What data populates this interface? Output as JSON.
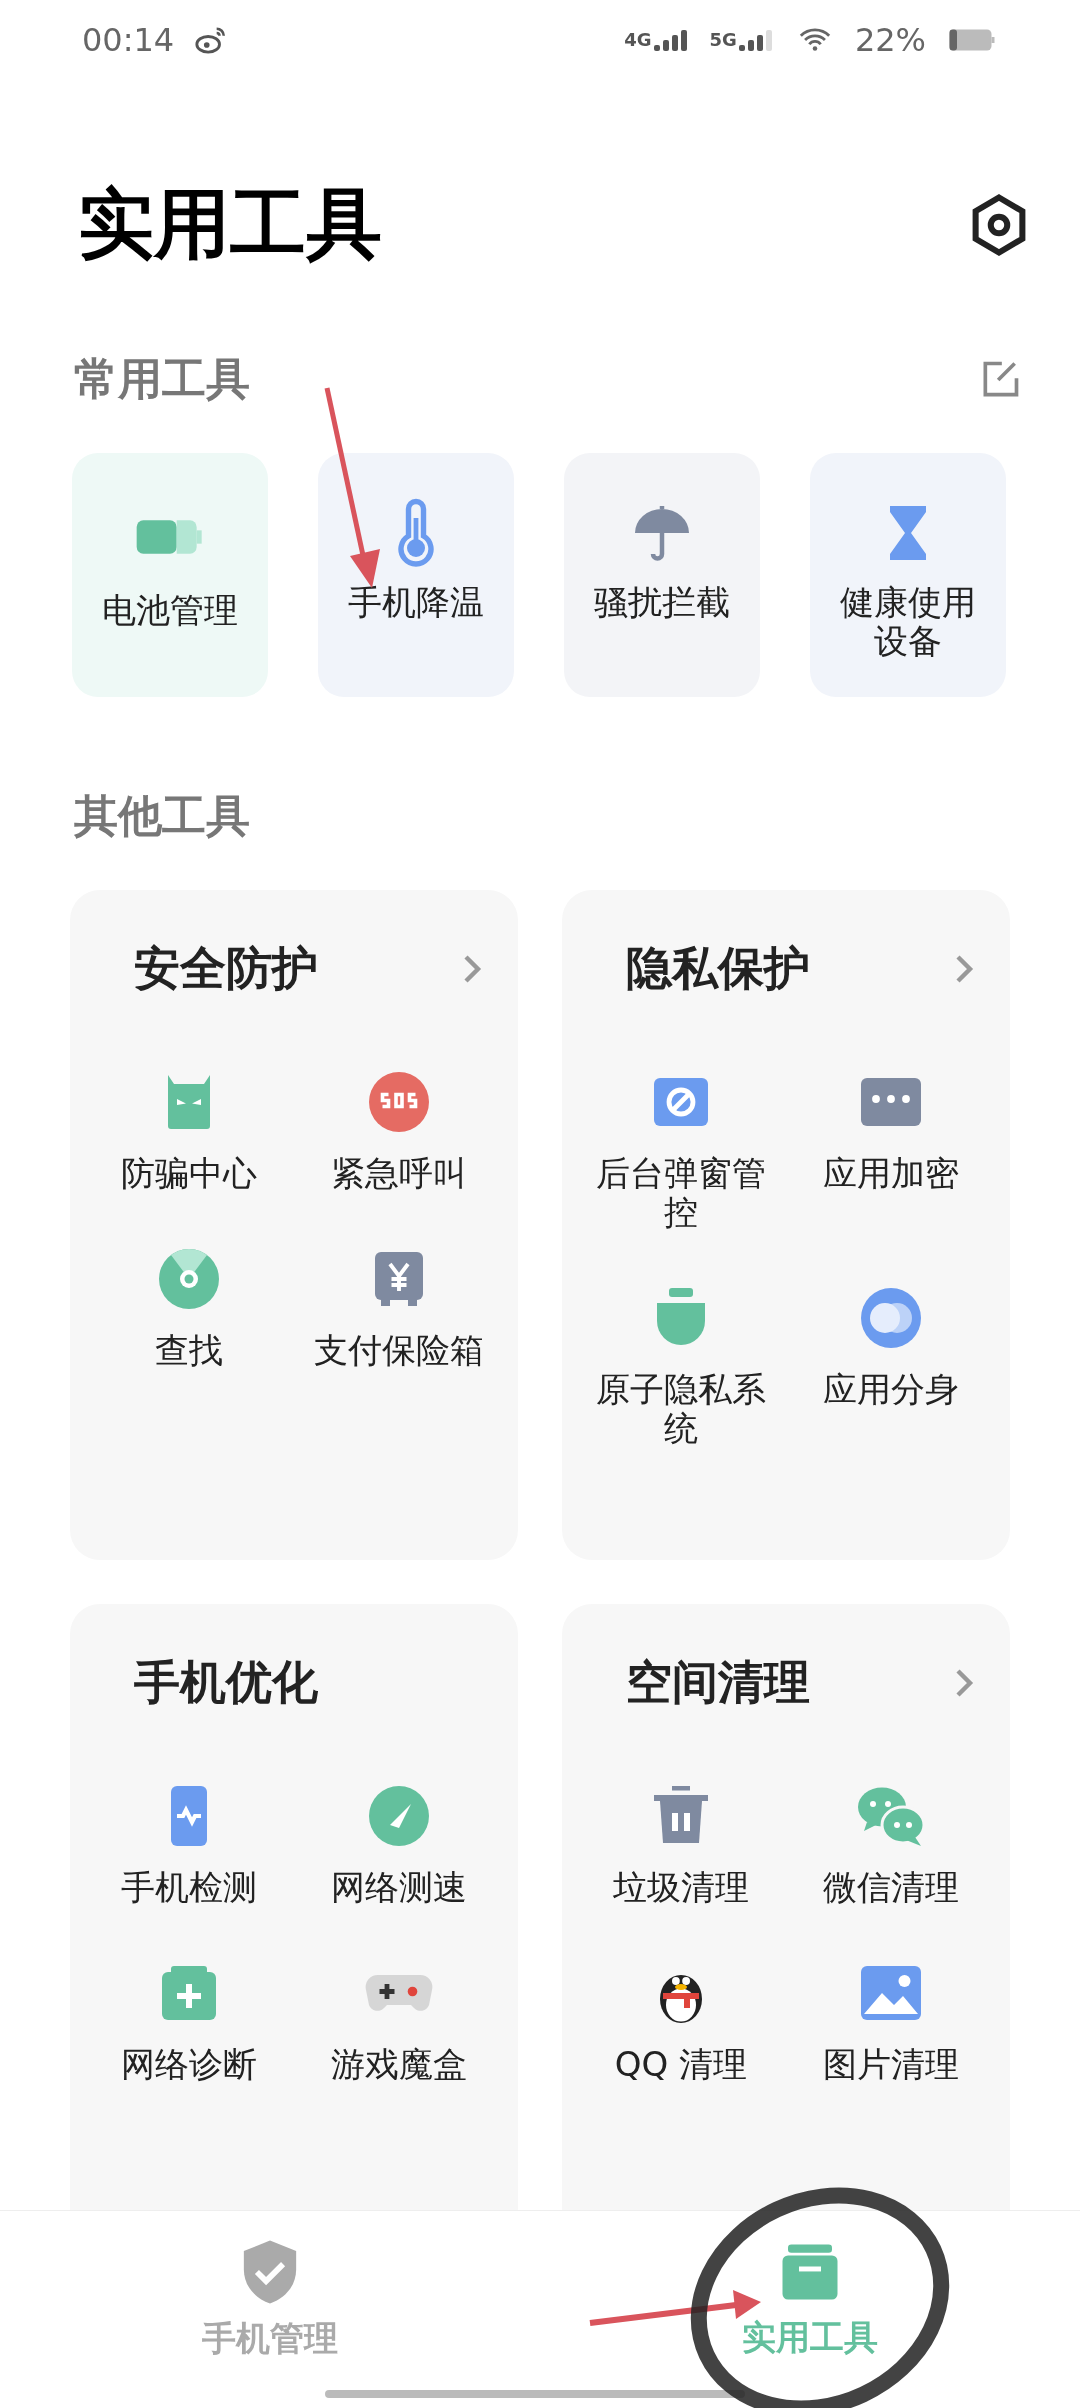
{
  "status_bar": {
    "time": "00:14",
    "network_4g": "4G",
    "network_5g": "5G",
    "battery": "22%"
  },
  "header": {
    "title": "实用工具"
  },
  "common_tools": {
    "title": "常用工具",
    "items": [
      {
        "label": "电池管理"
      },
      {
        "label": "手机降温"
      },
      {
        "label": "骚扰拦截"
      },
      {
        "label": "健康使用设备"
      }
    ]
  },
  "other_tools": {
    "title": "其他工具",
    "groups": [
      {
        "title": "安全防护",
        "chevron": true,
        "items": [
          {
            "label": "防骗中心"
          },
          {
            "label": "紧急呼叫"
          },
          {
            "label": "查找"
          },
          {
            "label": "支付保险箱"
          }
        ]
      },
      {
        "title": "隐私保护",
        "chevron": true,
        "items": [
          {
            "label": "后台弹窗管控"
          },
          {
            "label": "应用加密"
          },
          {
            "label": "原子隐私系统"
          },
          {
            "label": "应用分身"
          }
        ]
      },
      {
        "title": "手机优化",
        "chevron": false,
        "items": [
          {
            "label": "手机检测"
          },
          {
            "label": "网络测速"
          },
          {
            "label": "网络诊断"
          },
          {
            "label": "游戏魔盒"
          }
        ]
      },
      {
        "title": "空间清理",
        "chevron": true,
        "items": [
          {
            "label": "垃圾清理"
          },
          {
            "label": "微信清理"
          },
          {
            "label": "QQ 清理"
          },
          {
            "label": "图片清理"
          }
        ]
      }
    ]
  },
  "bottom_nav": [
    {
      "label": "手机管理",
      "selected": false
    },
    {
      "label": "实用工具",
      "selected": true
    }
  ]
}
